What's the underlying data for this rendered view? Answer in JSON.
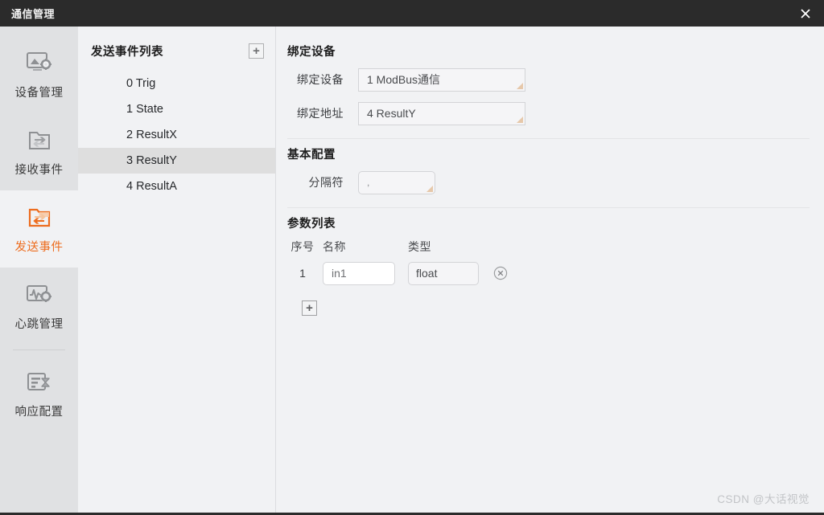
{
  "window": {
    "title": "通信管理",
    "close_label": "✕",
    "close_icon": "close-icon"
  },
  "sidebar": {
    "items": [
      {
        "label": "设备管理",
        "icon": "monitor-gear-icon",
        "active": false
      },
      {
        "label": "接收事件",
        "icon": "folder-receive-icon",
        "active": false
      },
      {
        "label": "发送事件",
        "icon": "folder-send-icon",
        "active": true
      },
      {
        "label": "心跳管理",
        "icon": "waveform-gear-icon",
        "active": false
      },
      {
        "label": "响应配置",
        "icon": "list-hourglass-icon",
        "active": false
      }
    ]
  },
  "event_list": {
    "title": "发送事件列表",
    "add_label": "+",
    "add_icon": "plus-icon",
    "items": [
      {
        "label": "0 Trig",
        "selected": false
      },
      {
        "label": "1 State",
        "selected": false
      },
      {
        "label": "2 ResultX",
        "selected": false
      },
      {
        "label": "3 ResultY",
        "selected": true
      },
      {
        "label": "4 ResultA",
        "selected": false
      }
    ]
  },
  "detail": {
    "bind_section": {
      "title": "绑定设备",
      "device_label": "绑定设备",
      "device_value": "1 ModBus通信",
      "address_label": "绑定地址",
      "address_value": "4 ResultY"
    },
    "basic_section": {
      "title": "基本配置",
      "separator_label": "分隔符",
      "separator_value": ","
    },
    "param_section": {
      "title": "参数列表",
      "columns": [
        "序号",
        "名称",
        "类型"
      ],
      "rows": [
        {
          "index": "1",
          "name": "in1",
          "type": "float",
          "delete_icon": "close-circle-icon"
        }
      ],
      "add_label": "+",
      "add_icon": "plus-icon"
    }
  },
  "watermark": {
    "text": "CSDN @大话视觉"
  },
  "colors": {
    "accent": "#ed6d1f",
    "titlebar": "#2b2b2b",
    "sidebar": "#e0e1e3",
    "panel": "#f1f2f4",
    "selected_row": "#dedede"
  }
}
